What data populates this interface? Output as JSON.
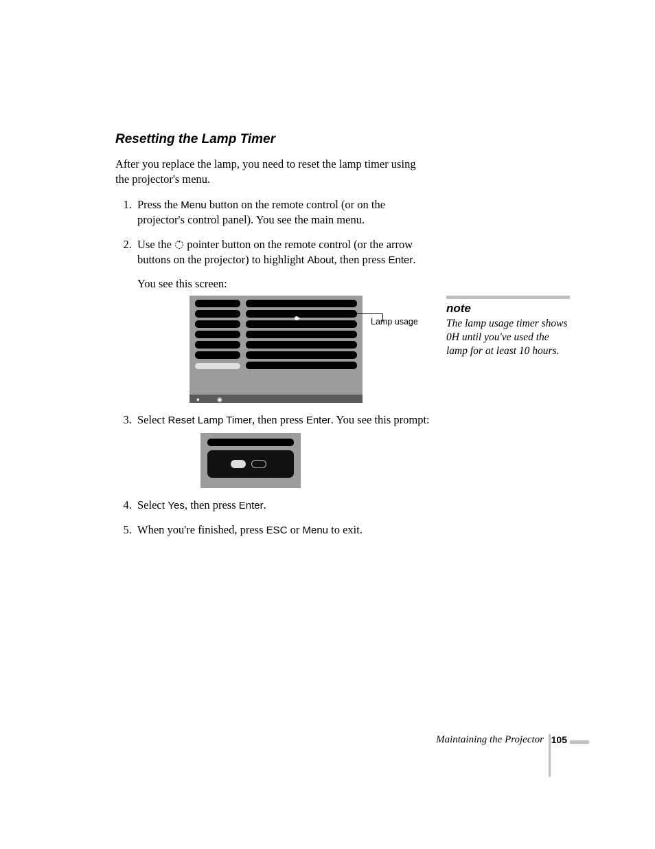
{
  "heading": "Resetting the Lamp Timer",
  "intro": "After you replace the lamp, you need to reset the lamp timer using the projector's menu.",
  "steps": {
    "s1a": "Press the ",
    "s1b": "Menu",
    "s1c": " button on the remote control (or on the projector's control panel). You see the main menu.",
    "s2a": "Use the ",
    "s2b": " pointer button on the remote control (or the arrow buttons on the projector) to highlight ",
    "s2c": "About",
    "s2d": ", then press ",
    "s2e": "Enter",
    "s2f": ".",
    "s2g": "You see this screen:",
    "s3a": "Select ",
    "s3b": "Reset Lamp Timer",
    "s3c": ", then press ",
    "s3d": "Enter",
    "s3e": ". You see this prompt:",
    "s4a": "Select ",
    "s4b": "Yes",
    "s4c": ", then press ",
    "s4d": "Enter",
    "s4e": ".",
    "s5a": "When you're finished, press ",
    "s5b": "ESC",
    "s5c": " or ",
    "s5d": "Menu",
    "s5e": " to exit."
  },
  "callout": "Lamp usage",
  "note": {
    "head": "note",
    "body": "The lamp usage timer shows 0H until you've used the lamp for at least 10 hours."
  },
  "footer": {
    "section": "Maintaining the Projector",
    "page": "105"
  }
}
